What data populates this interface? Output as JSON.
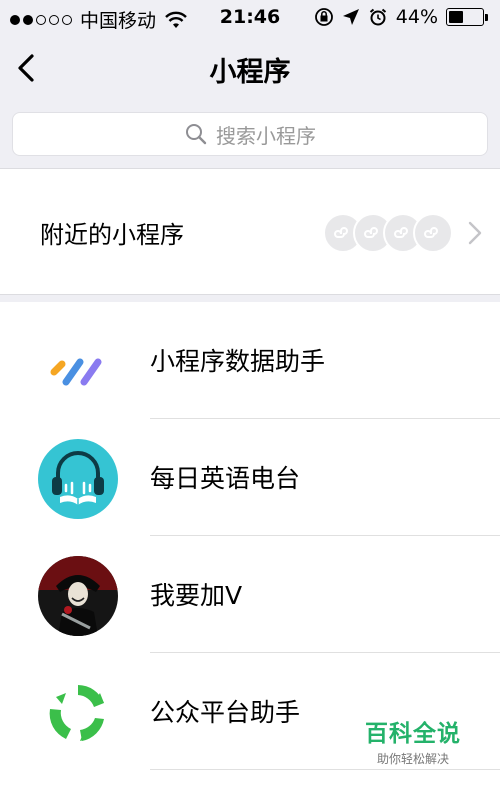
{
  "status_bar": {
    "carrier": "中国移动",
    "time": "21:46",
    "battery_percent": "44%",
    "battery_level": 0.44,
    "signal_bars_filled": 2,
    "signal_bars_total": 5
  },
  "nav": {
    "title": "小程序",
    "back_icon": "chevron-left-icon"
  },
  "search": {
    "placeholder": "搜索小程序",
    "icon": "search-icon"
  },
  "nearby": {
    "label": "附近的小程序",
    "badge_icon": "mini-program-logo-icon",
    "badge_count": 4
  },
  "mini_programs": [
    {
      "label": "小程序数据助手",
      "icon": "data-assistant-icon"
    },
    {
      "label": "每日英语电台",
      "icon": "english-radio-headphones-icon"
    },
    {
      "label": "我要加V",
      "icon": "avatar-mask-icon"
    },
    {
      "label": "公众平台助手",
      "icon": "platform-assistant-icon"
    }
  ],
  "watermark": {
    "title": "百科全说",
    "subtitle": "助你轻松解决"
  },
  "colors": {
    "background": "#efeff4",
    "watermark_green": "#24b26a",
    "badge_grey": "#e8e8ea",
    "radio_teal": "#35c4d3",
    "platform_green": "#3bbf4a"
  }
}
